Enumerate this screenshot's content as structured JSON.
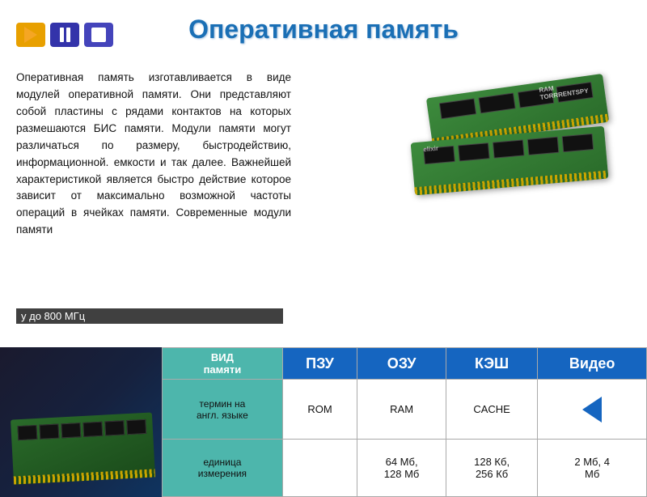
{
  "nav": {
    "arrow_label": "→",
    "pause_label": "▐▐",
    "stop_label": "■"
  },
  "title": "Оперативная память",
  "body_text": "Оперативная память  изготавливается в виде модулей оперативной памяти. Они представляют собой пластины с рядами контактов на которых размешаются БИС памяти. Модули памяти могут различаться по  размеру, быстродействию, информационной. емкости и так далее. Важнейшей характеристикой является быстро действие  которое зависит от максимально  возможной  частоты операций  в ячейках памяти. Современные модули памяти",
  "speed_text": "у до 800 МГц",
  "table": {
    "headers": [
      "ВИД\nпамяти",
      "ПЗУ",
      "ОЗУ",
      "КЭШ",
      "Видео"
    ],
    "row1_label": "термин на\nангл. языке",
    "row1_data": [
      "ROM",
      "RAM",
      "CACHE",
      ""
    ],
    "row2_label": "единица\nизмерения",
    "row2_data": [
      "",
      "64 Мб,\n128 Мб",
      "128 Кб,\n256 Кб",
      "2 Мб, 4\nМб"
    ]
  },
  "ram_label1": "RAM",
  "ram_label2": "TORRRENTSPY",
  "brand": "elixir"
}
